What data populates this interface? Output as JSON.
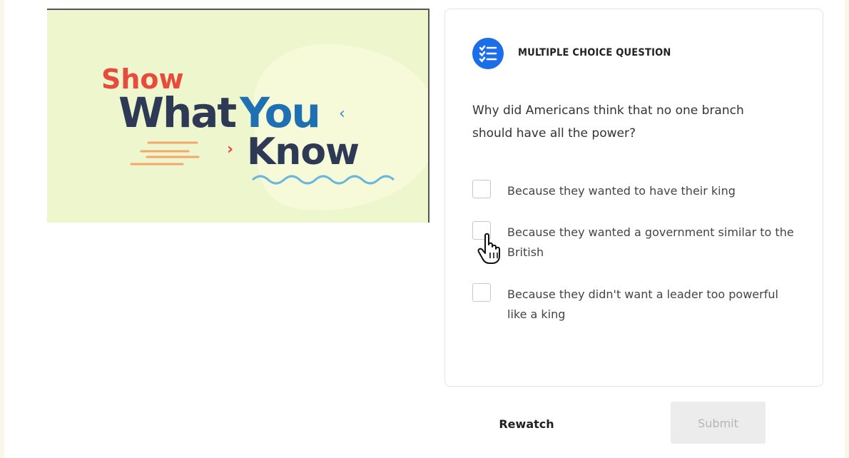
{
  "video": {
    "title_line1": "Show",
    "title_what": "What",
    "title_you": "You",
    "title_know": "Know",
    "colors": {
      "background": "#eef6cd",
      "blob": "#f6fad9",
      "show": "#e84b3c",
      "dark": "#2e3a55",
      "blue": "#1f6fb3",
      "wave": "#6bb6dd",
      "dashes": "#f2a86b"
    }
  },
  "question_card": {
    "type_label": "MULTIPLE CHOICE QUESTION",
    "type_icon": "checklist-icon",
    "question": "Why did Americans think that no one branch should have all the power?",
    "options": [
      {
        "label": "Because they wanted to have their king",
        "checked": false
      },
      {
        "label": "Because they wanted a government similar to the British",
        "checked": false
      },
      {
        "label": "Because they didn't want a leader too powerful like a king",
        "checked": false
      }
    ]
  },
  "actions": {
    "rewatch_label": "Rewatch",
    "submit_label": "Submit",
    "submit_enabled": false
  },
  "cursor": {
    "icon": "hand-pointer-icon"
  }
}
